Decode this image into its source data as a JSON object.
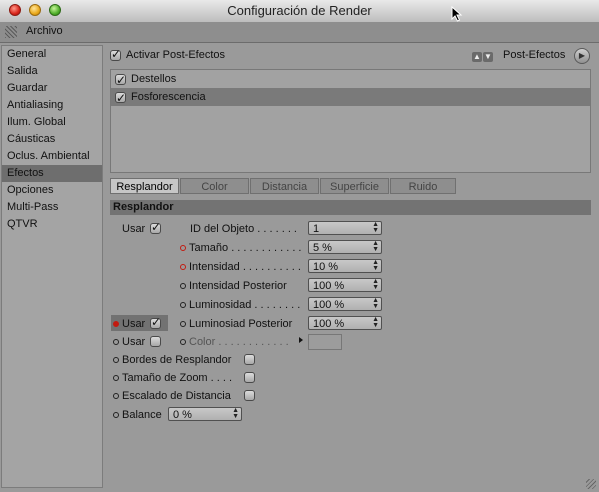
{
  "window": {
    "title": "Configuración de Render"
  },
  "menu": {
    "archivo": "Archivo"
  },
  "sidebar": {
    "items": [
      {
        "label": "General",
        "selected": false
      },
      {
        "label": "Salida",
        "selected": false
      },
      {
        "label": "Guardar",
        "selected": false
      },
      {
        "label": "Antialiasing",
        "selected": false
      },
      {
        "label": "Ilum. Global",
        "selected": false
      },
      {
        "label": "Cáusticas",
        "selected": false
      },
      {
        "label": "Oclus. Ambiental",
        "selected": false
      },
      {
        "label": "Efectos",
        "selected": true
      },
      {
        "label": "Opciones",
        "selected": false
      },
      {
        "label": "Multi-Pass",
        "selected": false
      },
      {
        "label": "QTVR",
        "selected": false
      }
    ]
  },
  "post": {
    "activate_label": "Activar Post-Efectos",
    "activate_checked": true,
    "menu_label": "Post-Efectos"
  },
  "effects": [
    {
      "label": "Destellos",
      "checked": true,
      "selected": false
    },
    {
      "label": "Fosforescencia",
      "checked": true,
      "selected": true
    }
  ],
  "tabs": [
    "Resplandor",
    "Color",
    "Distancia",
    "Superficie",
    "Ruido"
  ],
  "active_tab": "Resplandor",
  "section": {
    "title": "Resplandor"
  },
  "params": {
    "usar1": "Usar",
    "id_objeto": {
      "label": "ID del Objeto . . . . . . .",
      "value": "1"
    },
    "tamano": {
      "label": "Tamaño . . . . . . . . . . . .",
      "value": "5 %"
    },
    "intensidad": {
      "label": "Intensidad . . . . . . . . . .",
      "value": "10 %"
    },
    "intensidad_posterior": {
      "label": "Intensidad Posterior",
      "value": "100 %"
    },
    "luminosidad": {
      "label": "Luminosidad . . . . . . . .",
      "value": "100 %"
    },
    "usar2": "Usar",
    "luminosidad_posterior": {
      "label": "Luminosiad Posterior",
      "value": "100 %"
    },
    "usar3": "Usar",
    "color": {
      "label": "Color . . . . . . . . . . . ."
    },
    "bordes": "Bordes de Resplandor",
    "tamano_zoom": "Tamaño de Zoom . . . .",
    "escalado": "Escalado de Distancia",
    "balance": {
      "label": "Balance",
      "value": "0 %"
    }
  },
  "colors": {
    "accent_red": "#c21a10",
    "panel": "#9a9a9a",
    "selected": "#6e6e6e"
  }
}
